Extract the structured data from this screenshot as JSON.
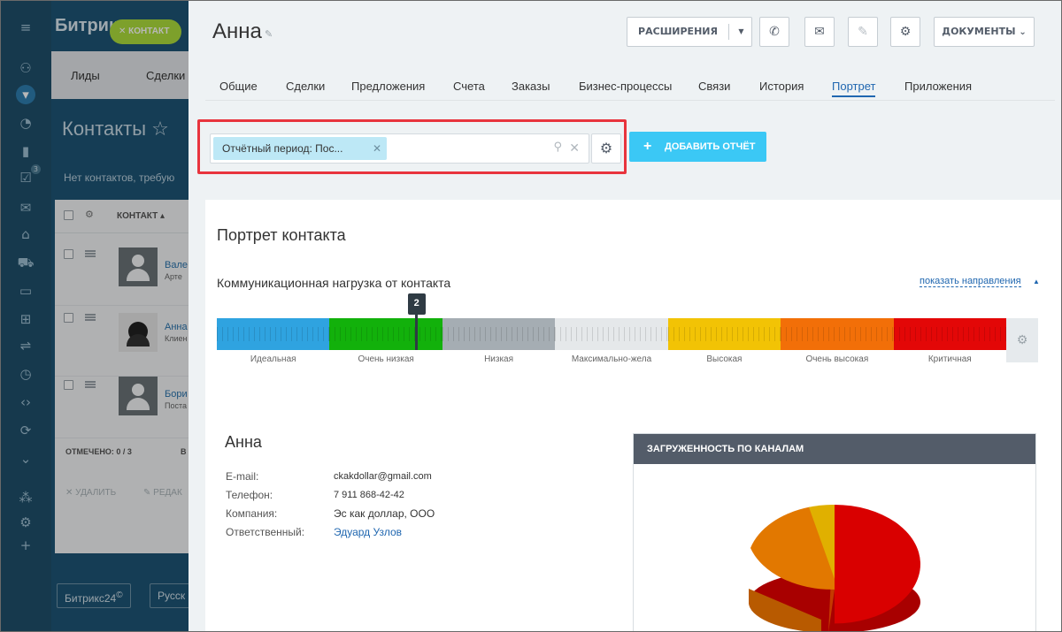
{
  "background_app": {
    "logo": "Битрик",
    "contact_button": "КОНТАКТ",
    "tabs": [
      "Лиды",
      "Сделки"
    ],
    "title": "Контакты",
    "subtitle": "Нет контактов, требую",
    "list_header": "КОНТАКТ",
    "rows": [
      {
        "name": "Вале",
        "sub": "Арте"
      },
      {
        "name": "Анна",
        "sub": "Клиен"
      },
      {
        "name": "Бори",
        "sub": "Поста"
      }
    ],
    "marked": "ОТМЕЧЕНО: 0 / 3",
    "marked_extra": "В",
    "delete_action": "УДАЛИТЬ",
    "edit_action": "РЕДАК",
    "footer_logo": "Битрикс24",
    "footer_logo_mark": "©",
    "footer_lang": "Русск"
  },
  "nav_icons": [
    "menu-icon",
    "android-icon",
    "filter-icon",
    "chart-icon",
    "tasks-icon",
    "mail-icon",
    "store-icon",
    "cart-icon",
    "window-icon",
    "apps-icon",
    "sliders-icon",
    "clock-icon",
    "code-icon",
    "sync-icon",
    "down-icon",
    "org-icon",
    "gear-icon",
    "plus-icon"
  ],
  "nav_task_count": "3",
  "panel": {
    "title": "Анна",
    "toolbar": {
      "extensions": "РАСШИРЕНИЯ",
      "documents": "ДОКУМЕНТЫ"
    },
    "tabs": [
      "Общие",
      "Сделки",
      "Предложения",
      "Счета",
      "Заказы",
      "Бизнес-процессы",
      "Связи",
      "История",
      "Портрет",
      "Приложения"
    ],
    "active_tab": "Портрет",
    "filter_chip": "Отчётный период: Пос...",
    "add_report": "ДОБАВИТЬ ОТЧЁТ"
  },
  "report": {
    "title": "Портрет контакта",
    "load_title": "Коммуникационная нагрузка от контакта",
    "show_directions": "показать направления",
    "scale": {
      "marker_value": "2",
      "marker_fraction": 0.253,
      "segments": [
        {
          "label": "Идеальная",
          "color": "#2fa3e0"
        },
        {
          "label": "Очень низкая",
          "color": "#12b10b"
        },
        {
          "label": "Низкая",
          "color": "#a5adb3"
        },
        {
          "label": "Максимально-жела",
          "color": "#e5e8ea"
        },
        {
          "label": "Высокая",
          "color": "#f2c305"
        },
        {
          "label": "Очень высокая",
          "color": "#f26f08"
        },
        {
          "label": "Критичная",
          "color": "#e30707"
        }
      ]
    },
    "contact": {
      "name": "Анна",
      "fields": [
        {
          "key": "E-mail:",
          "value": "ckakdollar@gmail.com"
        },
        {
          "key": "Телефон:",
          "value": "7 911 868-42-42"
        },
        {
          "key": "Компания:",
          "value": "Эс как доллар, ООО"
        },
        {
          "key": "Ответственный:",
          "value": "Эдуард Узлов"
        }
      ]
    },
    "channels_title": "ЗАГРУЖЕННОСТЬ ПО КАНАЛАМ"
  }
}
